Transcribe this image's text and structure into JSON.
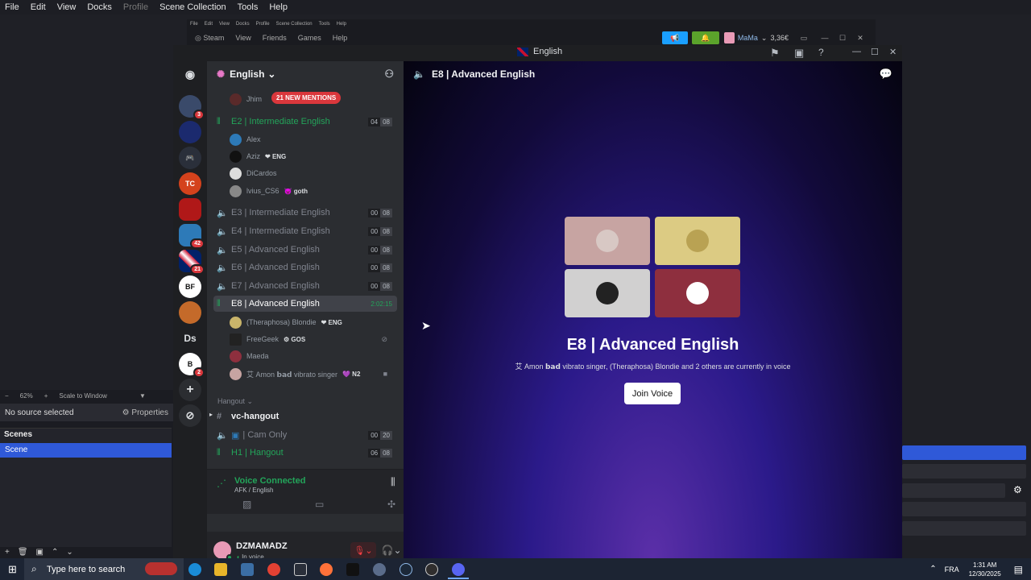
{
  "obs": {
    "menu": [
      "File",
      "Edit",
      "View",
      "Docks",
      "Profile",
      "Scene Collection",
      "Tools",
      "Help"
    ],
    "zoom": "62%",
    "scale_mode": "Scale to Window",
    "no_source": "No source selected",
    "properties": "Properties",
    "scenes_title": "Scenes",
    "scene_name": "Scene"
  },
  "steam": {
    "menu": [
      "File",
      "Edit",
      "View",
      "Docks",
      "Profile",
      "Scene Collection",
      "Tools",
      "Help"
    ],
    "nav": [
      "Steam",
      "View",
      "Friends",
      "Games",
      "Help"
    ],
    "account": "MaMa",
    "balance": "3,36€"
  },
  "discord": {
    "window_title": "English",
    "guild_name": "English",
    "mentions": "21 NEW MENTIONS",
    "server_badges": {
      "s1": "3",
      "s7": "42",
      "s8": "21",
      "s10": "2"
    },
    "server_ds": "Ds",
    "channels": [
      {
        "name": "E2 | Intermediate English",
        "count_a": "04",
        "count_b": "08"
      },
      {
        "name": "E3 | Intermediate English",
        "count_a": "00",
        "count_b": "08"
      },
      {
        "name": "E4 | Intermediate English",
        "count_a": "00",
        "count_b": "08"
      },
      {
        "name": "E5 | Advanced English",
        "count_a": "00",
        "count_b": "08"
      },
      {
        "name": "E6 | Advanced English",
        "count_a": "00",
        "count_b": "08"
      },
      {
        "name": "E7 | Advanced English",
        "count_a": "00",
        "count_b": "08"
      },
      {
        "name": "E8 | Advanced English",
        "timer": "2:02:15"
      }
    ],
    "users_top": {
      "jhim": "Jhim"
    },
    "users_e2": [
      {
        "name": "Alex",
        "tag": ""
      },
      {
        "name": "Aziz",
        "tag": "❤ ENG"
      },
      {
        "name": "DiCardos",
        "tag": ""
      },
      {
        "name": "lvius_CS6",
        "tag": "😈 goth"
      }
    ],
    "users_e8": [
      {
        "name": "(Theraphosa) Blondie",
        "tag": "❤ ENG"
      },
      {
        "name": "FreeGeek",
        "tag": "⚙ GOS"
      },
      {
        "name": "Maeda",
        "tag": ""
      },
      {
        "name": "艾 Amon 𝗯𝗮𝗱 vibrato singer",
        "tag": "💜 N2"
      }
    ],
    "category": "Hangout",
    "hangout_channels": [
      {
        "name": "vc-hangout"
      },
      {
        "name": "| Cam Only",
        "count_a": "00",
        "count_b": "20"
      },
      {
        "name": "H1 | Hangout",
        "count_a": "06",
        "count_b": "08"
      }
    ],
    "voice_status": "Voice Connected",
    "voice_location": "AFK / English",
    "username": "DZMAMADZ",
    "user_status": "In voice",
    "main": {
      "header": "E8 | Advanced English",
      "title": "E8 | Advanced English",
      "subtitle": "艾 Amon 𝗯𝗮𝗱 vibrato singer, (Theraphosa) Blondie and 2 others are currently in voice",
      "join": "Join Voice",
      "tile_colors": [
        "#c7a4a2",
        "#dccb83",
        "#d1d0d0",
        "#8e2f3e"
      ]
    }
  },
  "taskbar": {
    "search_placeholder": "Type here to search",
    "lang": "FRA",
    "time": "1:31 AM",
    "date": "12/30/2025"
  }
}
